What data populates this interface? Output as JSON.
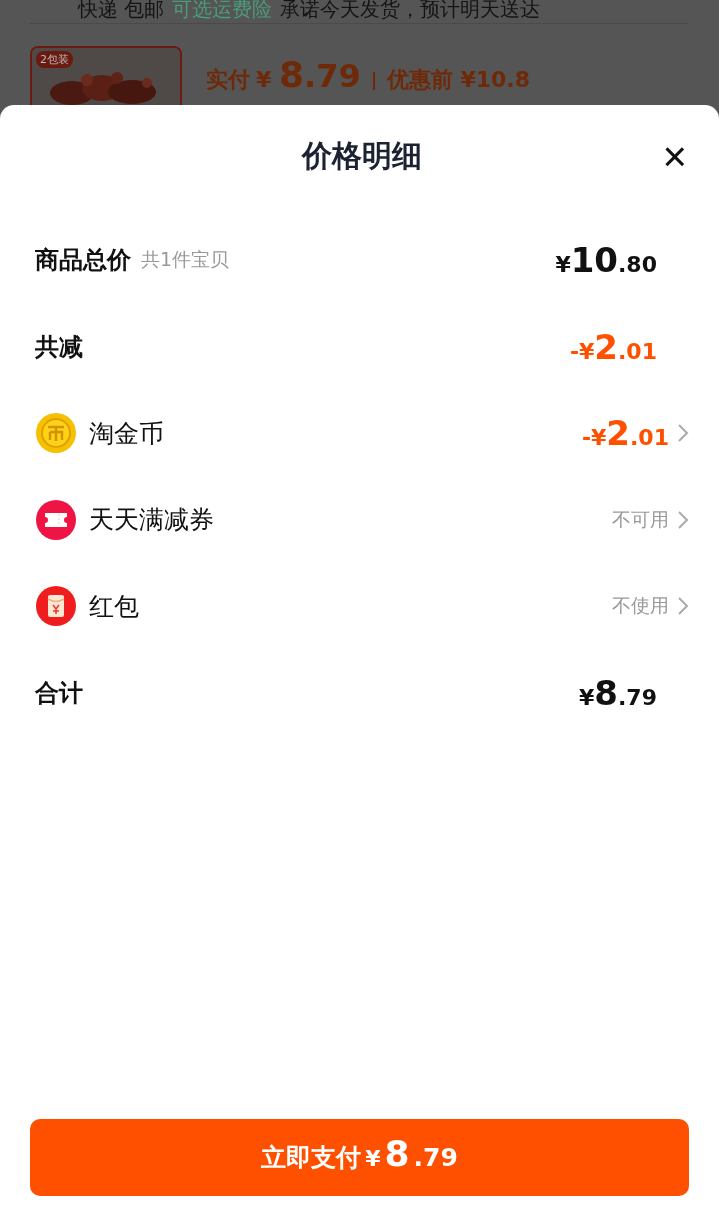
{
  "background_page": {
    "shipping_line": [
      {
        "text": "快递 包邮",
        "kind": "plain"
      },
      {
        "text": "可选运费险",
        "kind": "link"
      },
      {
        "text": "承诺今天发货，预计明天送达",
        "kind": "plain"
      }
    ],
    "product": {
      "image": {
        "kind": "picture",
        "badge": "2包装"
      },
      "paid_label": "实付",
      "paid_currency": "¥",
      "paid_integer": "8",
      "paid_decimal": ".79",
      "before_label": "优惠前",
      "before_price": "¥10.8"
    }
  },
  "sheet": {
    "title": "价格明细",
    "close": "×",
    "rows": [
      {
        "kind": "total",
        "label": "商品总价",
        "note": "共1件宝贝",
        "value": {
          "kind": "price",
          "prefix": "¥",
          "integer": "10",
          "decimal": ".80",
          "color": "#111111"
        }
      },
      {
        "kind": "discount",
        "label": "共减",
        "value": {
          "kind": "price",
          "prefix": "-¥",
          "integer": "2",
          "decimal": ".01",
          "color": "#ff5000"
        }
      },
      {
        "kind": "coin",
        "label": "淘金币",
        "value": {
          "kind": "price",
          "prefix": "-¥",
          "integer": "2",
          "decimal": ".01",
          "color": "#ff5000"
        }
      },
      {
        "kind": "coupon",
        "label": "天天满减券",
        "value": {
          "kind": "status",
          "text": "不可用"
        }
      },
      {
        "kind": "envelope",
        "label": "红包",
        "value": {
          "kind": "status",
          "text": "不使用"
        }
      },
      {
        "kind": "sum",
        "label": "合计",
        "value": {
          "kind": "price",
          "prefix": "¥",
          "integer": "8",
          "decimal": ".79",
          "color": "#111111"
        }
      }
    ],
    "pay_button": {
      "label": "立即支付",
      "currency": "¥",
      "integer": "8",
      "decimal": ".79"
    }
  }
}
